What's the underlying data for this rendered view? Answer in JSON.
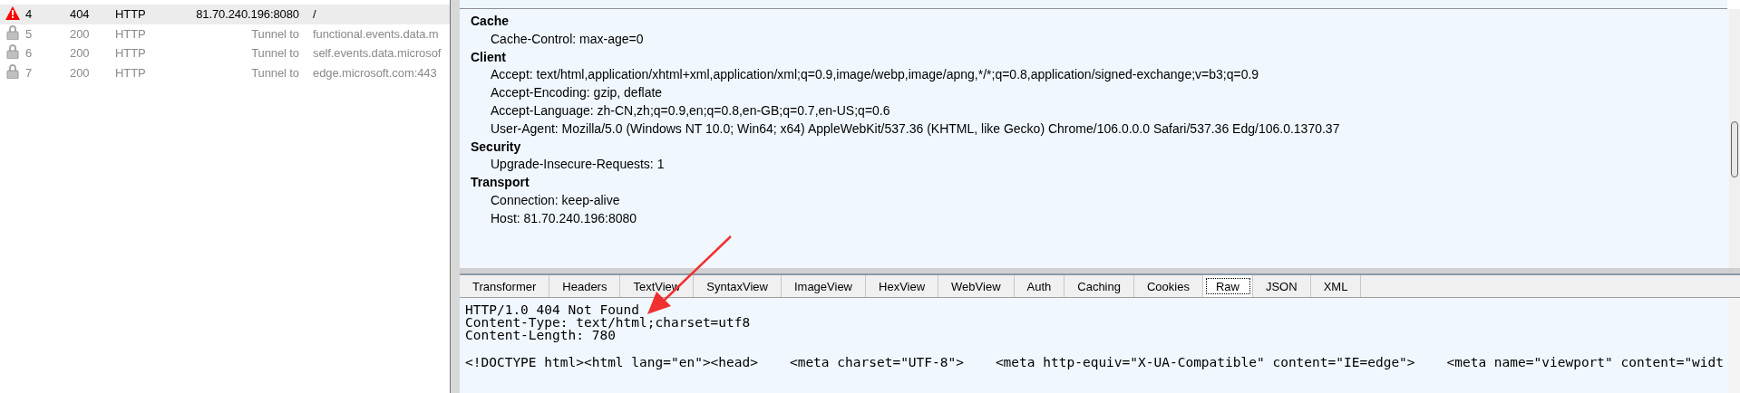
{
  "sessions": [
    {
      "kind": "error",
      "number": "4",
      "result": "404",
      "protocol": "HTTP",
      "host": "81.70.240.196:8080",
      "url": "/",
      "selected": true
    },
    {
      "kind": "tunnel",
      "number": "5",
      "result": "200",
      "protocol": "HTTP",
      "host": "Tunnel to",
      "url": "functional.events.data.m",
      "selected": false
    },
    {
      "kind": "tunnel",
      "number": "6",
      "result": "200",
      "protocol": "HTTP",
      "host": "Tunnel to",
      "url": "self.events.data.microsof",
      "selected": false
    },
    {
      "kind": "tunnel",
      "number": "7",
      "result": "200",
      "protocol": "HTTP",
      "host": "Tunnel to",
      "url": "edge.microsoft.com:443",
      "selected": false
    }
  ],
  "request_headers": [
    {
      "group": "Cache",
      "headers": [
        "Cache-Control: max-age=0"
      ]
    },
    {
      "group": "Client",
      "headers": [
        "Accept: text/html,application/xhtml+xml,application/xml;q=0.9,image/webp,image/apng,*/*;q=0.8,application/signed-exchange;v=b3;q=0.9",
        "Accept-Encoding: gzip, deflate",
        "Accept-Language: zh-CN,zh;q=0.9,en;q=0.8,en-GB;q=0.7,en-US;q=0.6",
        "User-Agent: Mozilla/5.0 (Windows NT 10.0; Win64; x64) AppleWebKit/537.36 (KHTML, like Gecko) Chrome/106.0.0.0 Safari/537.36 Edg/106.0.1370.37"
      ]
    },
    {
      "group": "Security",
      "headers": [
        "Upgrade-Insecure-Requests: 1"
      ]
    },
    {
      "group": "Transport",
      "headers": [
        "Connection: keep-alive",
        "Host: 81.70.240.196:8080"
      ]
    }
  ],
  "response_tabs": [
    {
      "label": "Transformer",
      "selected": false
    },
    {
      "label": "Headers",
      "selected": false
    },
    {
      "label": "TextView",
      "selected": false
    },
    {
      "label": "SyntaxView",
      "selected": false
    },
    {
      "label": "ImageView",
      "selected": false
    },
    {
      "label": "HexView",
      "selected": false
    },
    {
      "label": "WebView",
      "selected": false
    },
    {
      "label": "Auth",
      "selected": false
    },
    {
      "label": "Caching",
      "selected": false
    },
    {
      "label": "Cookies",
      "selected": false
    },
    {
      "label": "Raw",
      "selected": true
    },
    {
      "label": "JSON",
      "selected": false
    },
    {
      "label": "XML",
      "selected": false
    }
  ],
  "raw_response": {
    "headers": [
      "HTTP/1.0 404 Not Found",
      "Content-Type: text/html;charset=utf8",
      "Content-Length: 780"
    ],
    "body": "<!DOCTYPE html><html lang=\"en\"><head>    <meta charset=\"UTF-8\">    <meta http-equiv=\"X-UA-Compatible\" content=\"IE=edge\">    <meta name=\"viewport\" content=\"widt"
  }
}
